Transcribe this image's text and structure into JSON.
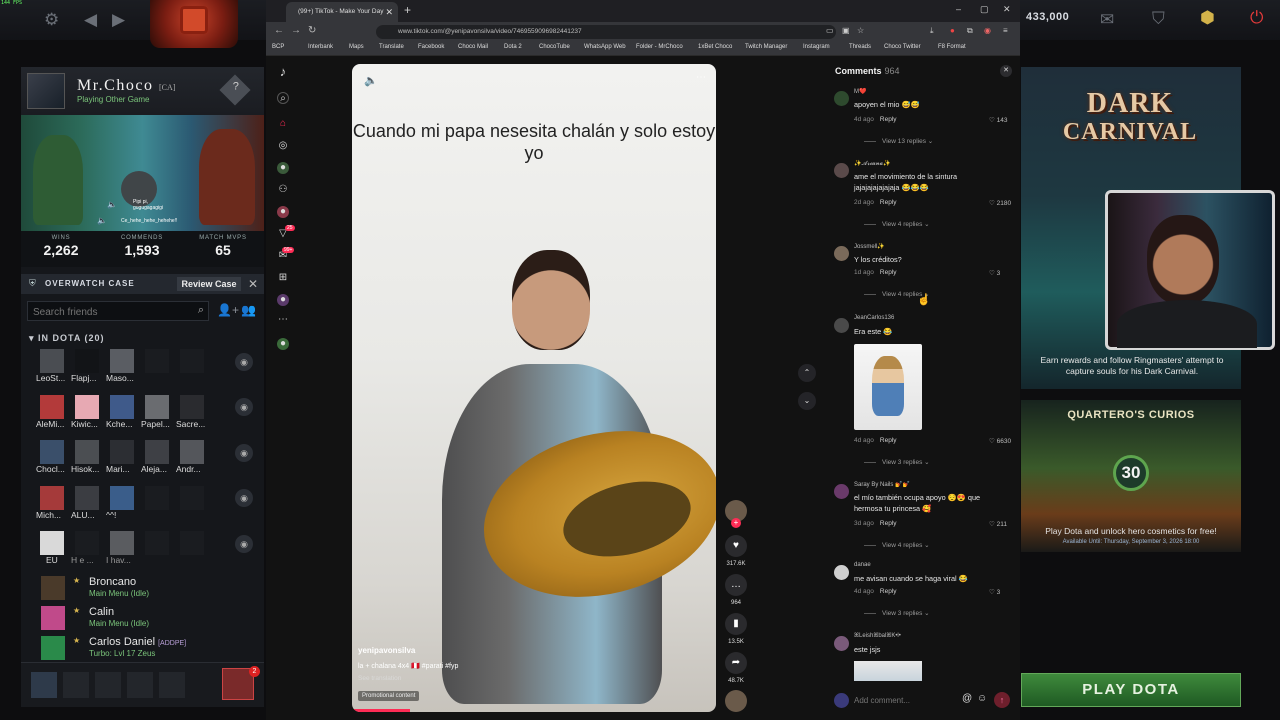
{
  "dota": {
    "fps": "144 FPS",
    "gold": "433,000",
    "profile": {
      "name": "Mr.Choco",
      "tag": "[CA]",
      "status": "Playing Other Game",
      "art_line1": "Pipi pi,",
      "art_line2": "gugugagagigi",
      "art_line3": "Ce_hehe_hehe_hehehe!!",
      "stats": [
        {
          "label": "WINS",
          "value": "2,262"
        },
        {
          "label": "COMMENDS",
          "value": "1,593"
        },
        {
          "label": "MATCH MVPS",
          "value": "65"
        }
      ]
    },
    "overwatch": {
      "title": "OVERWATCH CASE",
      "button": "Review Case"
    },
    "search_placeholder": "Search friends",
    "in_dota_label": "IN DOTA (20)",
    "friend_rows": [
      [
        "LeoSt...",
        "Flapj...",
        "Maso..."
      ],
      [
        "AleMi...",
        "Kiwic...",
        "Kche...",
        "Papel...",
        "Sacre..."
      ],
      [
        "Chocl...",
        "Hisok...",
        "Mari...",
        "Aleja...",
        "Andr..."
      ],
      [
        "Mich...",
        "ALU...",
        "^^!"
      ],
      [
        "EU",
        "H e ...",
        "I hav..."
      ]
    ],
    "friend_list": [
      {
        "name": "Broncano",
        "status": "Main Menu (Idle)"
      },
      {
        "name": "Calin",
        "status": "Main Menu (Idle)"
      },
      {
        "name": "Carlos Daniel",
        "tag": "[ADDPE]",
        "status": "Turbo: Lvl 17 Zeus"
      }
    ],
    "party_badge": "2",
    "promo1_text": "Earn rewards and follow Ringmasters' attempt to capture souls for his Dark Carnival.",
    "promo1_title_a": "DARK",
    "promo1_title_b": "CARNIVAL",
    "promo2_title": "QUARTERO'S CURIOS",
    "promo2_badge": "30",
    "promo2_text": "Play Dota and unlock hero cosmetics for free!",
    "promo2_sub": "Available Until: Thursday, September 3, 2026 18:00",
    "play_button": "PLAY DOTA"
  },
  "browser": {
    "tab_title": "(99+) TikTok - Make Your Day",
    "url": "www.tiktok.com/@yenipavonsilva/video/7469559096982441237",
    "bookmarks": [
      "BCP",
      "Interbank",
      "Maps",
      "Translate",
      "Facebook",
      "Choco Mail",
      "Dota 2",
      "ChocoTube",
      "WhatsApp Web",
      "Folder - MrChoco",
      "1xBet Choco",
      "Twitch Manager",
      "Instagram",
      "Threads",
      "Choco Twitter",
      "F8 Format"
    ]
  },
  "tiktok": {
    "badge_notifications": "25",
    "badge_inbox": "99+",
    "video": {
      "caption": "Cuando mi papa nesesita chalán y solo estoy yo",
      "username": "yenipavonsilva",
      "description": "la + chalana 4x4 🇵🇪 #parati #fyp",
      "see_translation": "See translation",
      "promo": "Promotional content",
      "likes": "317.6K",
      "comments": "964",
      "saves": "13.5K",
      "shares": "48.7K"
    },
    "comments_title": "Comments",
    "comments_count": "964",
    "comments": [
      {
        "user": "M❤️",
        "text": "apoyen el mio 😅😅",
        "age": "4d ago",
        "likes": "143",
        "replies": "View 13 replies"
      },
      {
        "user": "✨𝓐𝓻𝓲𝓪𝓷𝓪✨",
        "text": "ame el movimiento de la sintura jajajajajajajaja 😂😂😂",
        "age": "2d ago",
        "likes": "2180",
        "replies": "View 4 replies"
      },
      {
        "user": "Jossmell✨",
        "text": "Y los créditos?",
        "age": "1d ago",
        "likes": "3",
        "replies": "View 4 replies"
      },
      {
        "user": "JeanCarlos136",
        "text": "Era este 😂",
        "age": "4d ago",
        "likes": "6630",
        "replies": "View 3 replies"
      },
      {
        "user": "Saray By Nails 💅💅",
        "text": "el mío también ocupa apoyo 😌😍 que hermosa tu princesa 🥰",
        "age": "3d ago",
        "likes": "211",
        "replies": "View 4 replies"
      },
      {
        "user": "danae",
        "text": "me avisan cuando se haga viral 😂",
        "age": "4d ago",
        "likes": "3",
        "replies": "View 3 replies"
      },
      {
        "user": "ꕤLeishꕤbalꕤK•l•",
        "text": "este jsjs",
        "age": "",
        "likes": "",
        "replies": ""
      }
    ],
    "reply_label": "Reply",
    "add_comment_placeholder": "Add comment..."
  }
}
